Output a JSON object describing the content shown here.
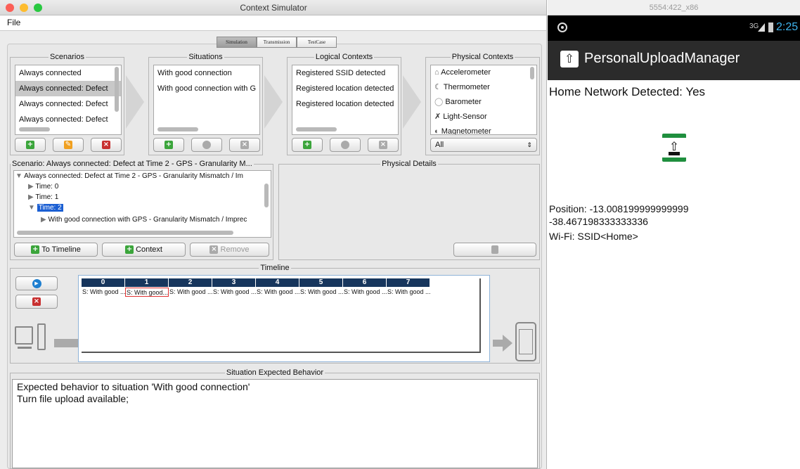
{
  "window": {
    "title": "Context Simulator",
    "menu": [
      "File"
    ]
  },
  "tabs": [
    {
      "label": "Simulation",
      "active": true
    },
    {
      "label": "Transmission",
      "active": false
    },
    {
      "label": "TestCase",
      "active": false
    }
  ],
  "scenarios": {
    "title": "Scenarios",
    "items": [
      {
        "label": "Always connected",
        "selected": false
      },
      {
        "label": "Always connected: Defect",
        "selected": true
      },
      {
        "label": "Always connected: Defect",
        "selected": false
      },
      {
        "label": "Always connected: Defect",
        "selected": false
      }
    ]
  },
  "situations": {
    "title": "Situations",
    "items": [
      {
        "label": "With good connection"
      },
      {
        "label": "With good connection with G"
      }
    ]
  },
  "logical_contexts": {
    "title": "Logical Contexts",
    "items": [
      {
        "label": "Registered SSID detected"
      },
      {
        "label": "Registered location detected"
      },
      {
        "label": "Registered location detected"
      }
    ]
  },
  "physical_contexts": {
    "title": "Physical Contexts",
    "items": [
      {
        "label": "Accelerometer",
        "icon": "accelerometer-icon"
      },
      {
        "label": "Thermometer",
        "icon": "thermometer-icon"
      },
      {
        "label": "Barometer",
        "icon": "barometer-icon"
      },
      {
        "label": "Light-Sensor",
        "icon": "light-sensor-icon"
      },
      {
        "label": "Magnetometer",
        "icon": "magnetometer-icon"
      }
    ],
    "filter_value": "All"
  },
  "scenario_panel": {
    "title": "Scenario: Always connected: Defect at Time 2 - GPS - Granularity M...",
    "root": "Always connected: Defect at Time 2 - GPS - Granularity Mismatch / Im",
    "times": [
      "Time: 0",
      "Time: 1",
      "Time: 2"
    ],
    "child": "With good connection with GPS - Granularity Mismatch / Imprec",
    "buttons": {
      "to_timeline": "To Timeline",
      "context": "Context",
      "remove": "Remove"
    }
  },
  "physical_details": {
    "title": "Physical Details"
  },
  "timeline": {
    "title": "Timeline",
    "columns": [
      "0",
      "1",
      "2",
      "3",
      "4",
      "5",
      "6",
      "7"
    ],
    "cells": [
      "S: With good ...",
      "S: With good...",
      "S: With good ...",
      "S: With good ...",
      "S: With good ...",
      "S: With good ...",
      "S: With good ...",
      "S: With good ..."
    ],
    "selected_index": 1
  },
  "expected_behavior": {
    "title": "Situation Expected Behavior",
    "lines": [
      "Expected behavior to situation 'With good connection'",
      "Turn file upload available;"
    ]
  },
  "emulator": {
    "window_title": "5554:422_x86",
    "status_time": "2:25",
    "network": "3G",
    "app_title": "PersonalUploadManager",
    "home_network": "Home Network Detected: Yes",
    "position_line1": "Position: -13.008199999999999",
    "position_line2": "-38.467198333333336",
    "wifi": "Wi-Fi: SSID<Home>"
  },
  "colors": {
    "accent": "#17365d",
    "selection": "#1b5fd3",
    "green": "#3ba53b",
    "red": "#c83030",
    "orange": "#f0a020"
  }
}
